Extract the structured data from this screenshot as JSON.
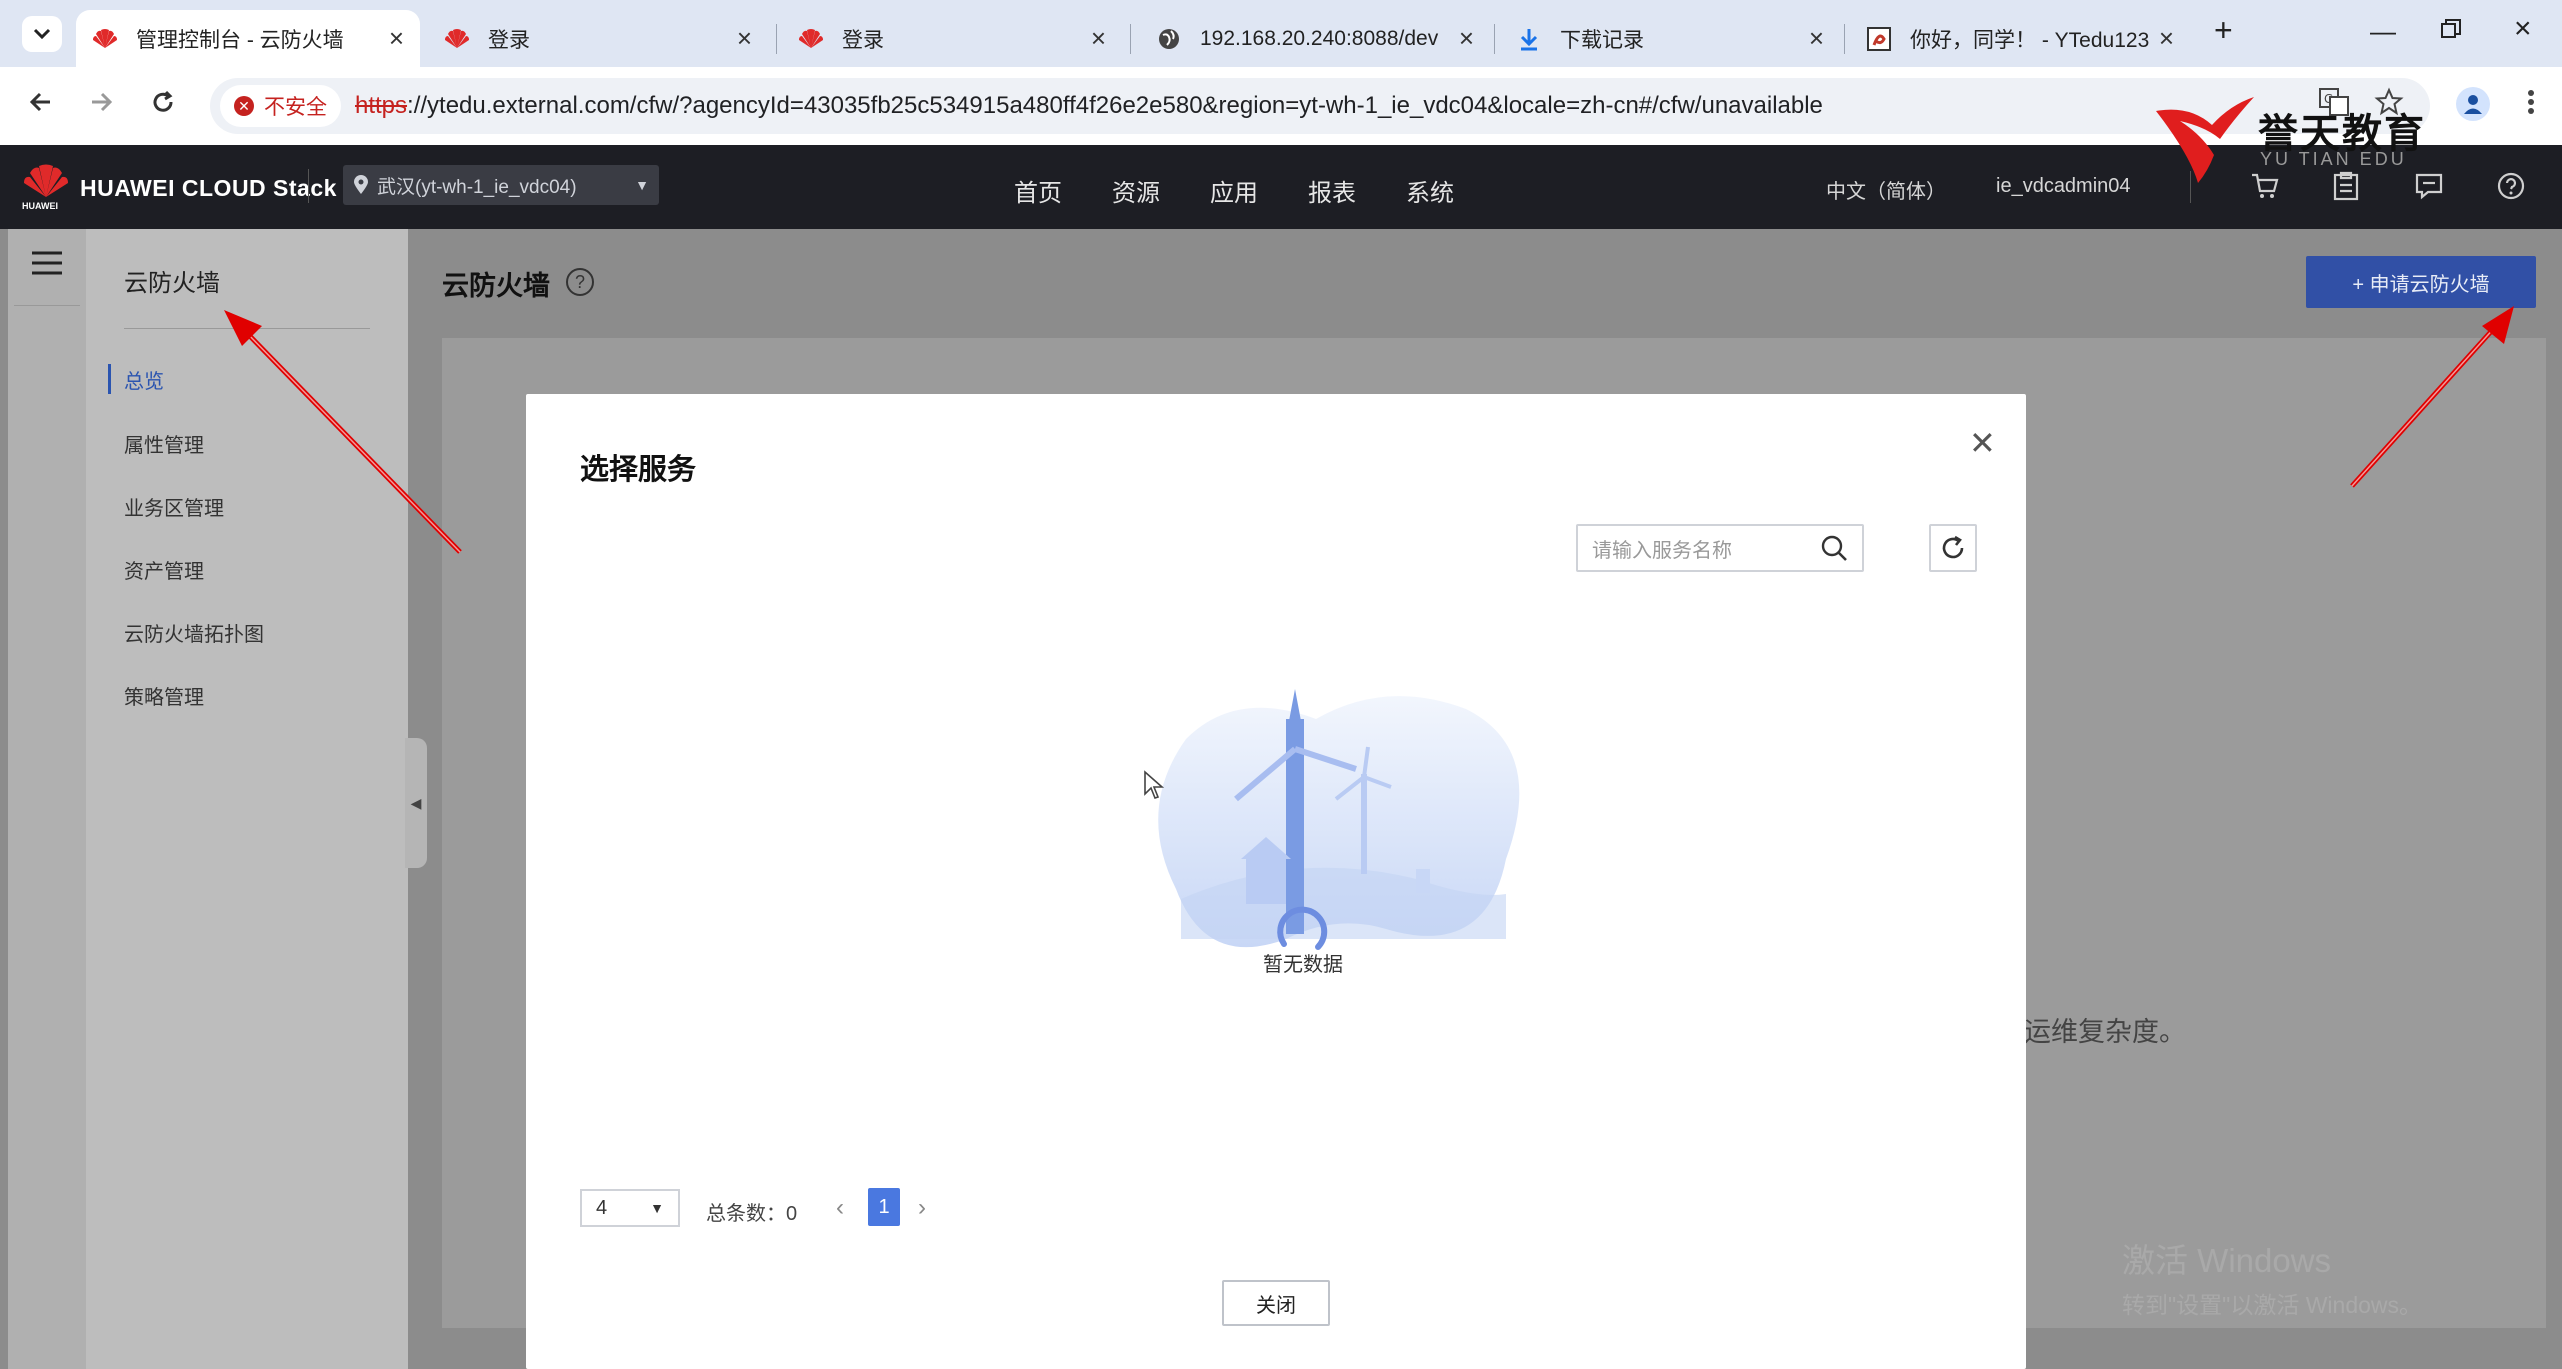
{
  "browser": {
    "tabs": [
      {
        "title": "管理控制台 - 云防火墙",
        "active": true,
        "icon": "huawei-icon"
      },
      {
        "title": "登录",
        "active": false,
        "icon": "huawei-icon"
      },
      {
        "title": "登录",
        "active": false,
        "icon": "huawei-icon"
      },
      {
        "title": "192.168.20.240:8088/dev",
        "active": false,
        "icon": "globe-icon"
      },
      {
        "title": "下载记录",
        "active": false,
        "icon": "download-icon"
      },
      {
        "title": "你好，同学！ - YTedu123",
        "active": false,
        "icon": "ytedu-icon"
      }
    ],
    "security_label": "不安全",
    "url_proto": "https",
    "url_rest": "://ytedu.external.com/cfw/?agencyId=43035fb25c534915a480ff4f26e2e580&region=yt-wh-1_ie_vdc04&locale=zh-cn#/cfw/unavailable"
  },
  "header": {
    "brand": "HUAWEI CLOUD Stack",
    "logo_text": "HUAWEI",
    "region": "武汉(yt-wh-1_ie_vdc04)",
    "nav": [
      "首页",
      "资源",
      "应用",
      "报表",
      "系统"
    ],
    "language": "中文（简体）",
    "username": "ie_vdcadmin04"
  },
  "sidebar": {
    "title": "云防火墙",
    "items": [
      {
        "label": "总览",
        "active": true
      },
      {
        "label": "属性管理",
        "active": false
      },
      {
        "label": "业务区管理",
        "active": false
      },
      {
        "label": "资产管理",
        "active": false
      },
      {
        "label": "云防火墙拓扑图",
        "active": false
      },
      {
        "label": "策略管理",
        "active": false
      }
    ]
  },
  "main": {
    "title": "云防火墙",
    "apply_button": "+ 申请云防火墙",
    "background_text": "运维复杂度。"
  },
  "dialog": {
    "title": "选择服务",
    "search_placeholder": "请输入服务名称",
    "empty_text": "暂无数据",
    "page_size": "4",
    "total_label": "总条数：0",
    "current_page": "1",
    "close_button": "关闭"
  },
  "watermark": {
    "name": "誉天教育",
    "sub": "YU TIAN EDU"
  },
  "os_activation": {
    "line1": "激活 Windows",
    "line2": "转到\"设置\"以激活 Windows。"
  },
  "colors": {
    "accent": "#3150a6",
    "page_active": "#4a78e0",
    "header_bg": "#1d1e24",
    "insecure": "#c5221f"
  }
}
